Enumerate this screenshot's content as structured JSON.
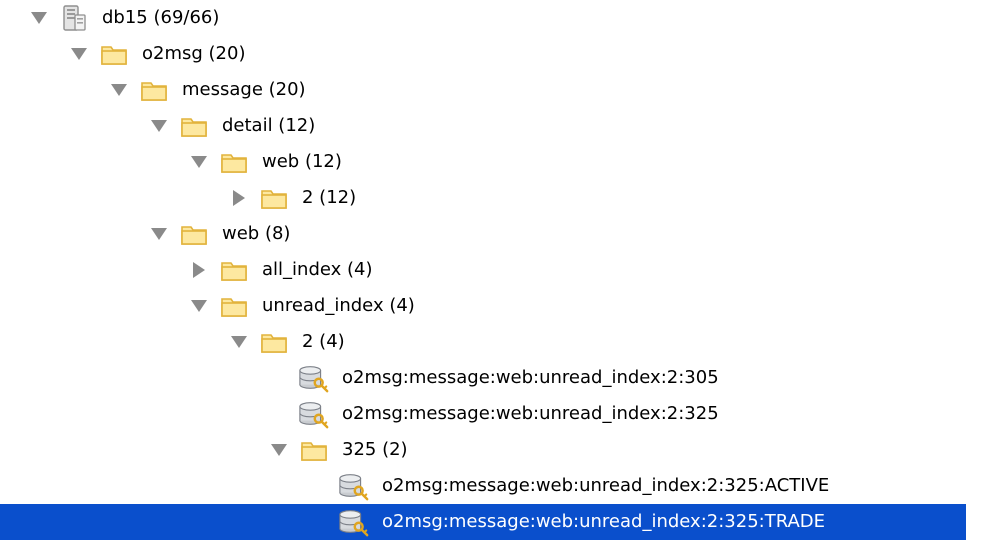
{
  "colors": {
    "selection": "#0a4fcc",
    "selection_text": "#ffffff",
    "text": "#000000",
    "triangle": "#8a8a8a",
    "folder_fill": "#fde8a0",
    "folder_edge": "#e2b33c",
    "key": "#e0a520"
  },
  "tree": {
    "rows": [
      {
        "label": "db15 (69/66)",
        "level": 0,
        "toggle": "expanded",
        "icon": "server-icon",
        "selected": false
      },
      {
        "label": "o2msg (20)",
        "level": 1,
        "toggle": "expanded",
        "icon": "folder-icon",
        "selected": false
      },
      {
        "label": "message (20)",
        "level": 2,
        "toggle": "expanded",
        "icon": "folder-icon",
        "selected": false
      },
      {
        "label": "detail (12)",
        "level": 3,
        "toggle": "expanded",
        "icon": "folder-icon",
        "selected": false
      },
      {
        "label": "web (12)",
        "level": 4,
        "toggle": "expanded",
        "icon": "folder-icon",
        "selected": false
      },
      {
        "label": "2 (12)",
        "level": 5,
        "toggle": "collapsed",
        "icon": "folder-icon",
        "selected": false
      },
      {
        "label": "web (8)",
        "level": 3,
        "toggle": "expanded",
        "icon": "folder-icon",
        "selected": false
      },
      {
        "label": "all_index (4)",
        "level": 4,
        "toggle": "collapsed",
        "icon": "folder-icon",
        "selected": false
      },
      {
        "label": "unread_index (4)",
        "level": 4,
        "toggle": "expanded",
        "icon": "folder-icon",
        "selected": false
      },
      {
        "label": "2 (4)",
        "level": 5,
        "toggle": "expanded",
        "icon": "folder-icon",
        "selected": false
      },
      {
        "label": "o2msg:message:web:unread_index:2:305",
        "level": 6,
        "toggle": "none",
        "icon": "database-key-icon",
        "selected": false
      },
      {
        "label": "o2msg:message:web:unread_index:2:325",
        "level": 6,
        "toggle": "none",
        "icon": "database-key-icon",
        "selected": false
      },
      {
        "label": "325 (2)",
        "level": 6,
        "toggle": "expanded",
        "icon": "folder-icon",
        "selected": false
      },
      {
        "label": "o2msg:message:web:unread_index:2:325:ACTIVE",
        "level": 7,
        "toggle": "none",
        "icon": "database-key-icon",
        "selected": false
      },
      {
        "label": "o2msg:message:web:unread_index:2:325:TRADE",
        "level": 7,
        "toggle": "none",
        "icon": "database-key-icon",
        "selected": true
      }
    ]
  }
}
